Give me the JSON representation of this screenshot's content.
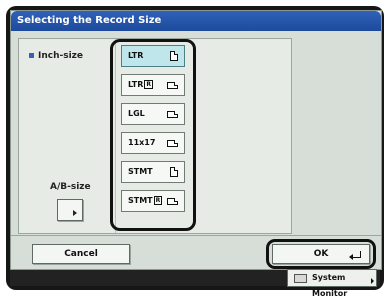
{
  "dialog": {
    "title": "Selecting the Record Size",
    "inch_label": "Inch-size",
    "ab_label": "A/B-size"
  },
  "sizes": [
    {
      "label": "LTR",
      "orientation": "portrait",
      "selected": true
    },
    {
      "label": "LTR",
      "suffix": "R",
      "orientation": "landscape",
      "selected": false
    },
    {
      "label": "LGL",
      "orientation": "landscape",
      "selected": false
    },
    {
      "label": "11x17",
      "orientation": "landscape",
      "selected": false
    },
    {
      "label": "STMT",
      "orientation": "portrait",
      "selected": false
    },
    {
      "label": "STMT",
      "suffix": "R",
      "orientation": "landscape",
      "selected": false
    }
  ],
  "footer": {
    "cancel_label": "Cancel",
    "ok_label": "OK",
    "system_monitor_label": "System Monitor"
  },
  "colors": {
    "title_bar": "#2f62b8",
    "selected_button": "#bfe6ea",
    "dialog_background": "#d7ded7"
  }
}
